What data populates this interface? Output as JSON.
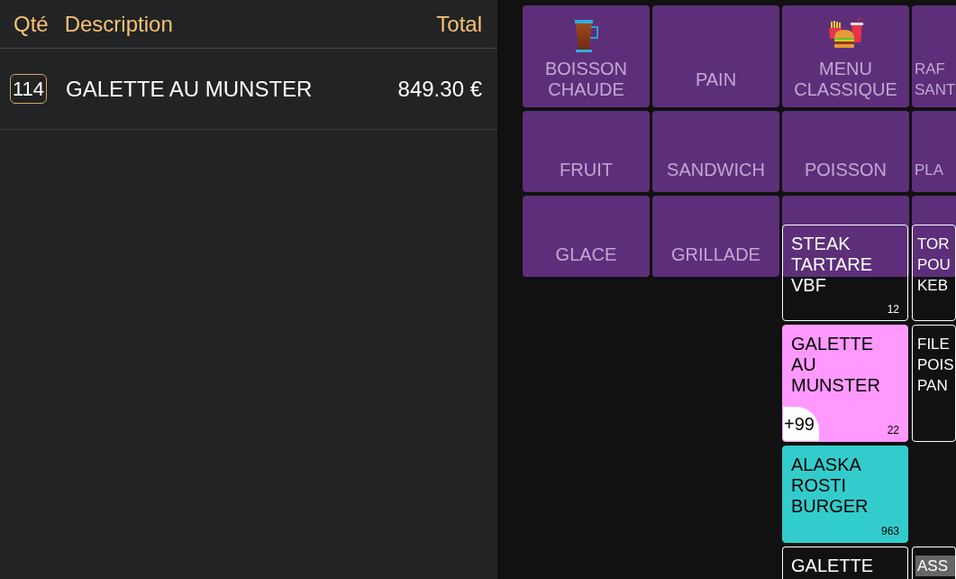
{
  "order": {
    "columns": [
      "Qté",
      "Description",
      "Total"
    ],
    "lines": [
      {
        "quantity": "114",
        "description": "GALETTE AU MUNSTER",
        "total": "849.30 €"
      }
    ]
  },
  "categories": [
    {
      "label": "BOISSON CHAUDE",
      "kind": "drink"
    },
    {
      "label": "PAIN",
      "kind": "text"
    },
    {
      "label": "MENU CLASSIQUE",
      "kind": "meal"
    },
    {
      "label": "RAF SANT",
      "kind": "text"
    },
    {
      "label": "FRUIT",
      "kind": "text"
    },
    {
      "label": "SANDWICH",
      "kind": "text"
    },
    {
      "label": "POISSON",
      "kind": "text"
    },
    {
      "label": "PLA",
      "kind": "text"
    },
    {
      "label": "GLACE",
      "kind": "text"
    },
    {
      "label": "GRILLADE",
      "kind": "text"
    },
    {
      "kind": "covered"
    },
    {
      "kind": "covered"
    }
  ],
  "products": {
    "rows": [
      [
        {
          "label": "STEAK TARTARE VBF",
          "count": "12",
          "highlighted": false
        },
        {
          "label": "TOR POU KEB",
          "highlighted": false
        }
      ],
      [
        {
          "label": "GALETTE AU MUNSTER",
          "count": "22",
          "badge": "+99",
          "color": "#ff99ff",
          "highlighted": false
        },
        {
          "label": "FILE POIS PAN",
          "highlighted": false
        }
      ],
      [
        {
          "label": "ALASKA ROSTI BURGER",
          "count": "963",
          "color": "#33cccc",
          "highlighted": false
        }
      ],
      [
        {
          "label": "GALETTE",
          "highlighted": false
        },
        {
          "label": "ASS",
          "highlighted": true
        }
      ]
    ]
  }
}
